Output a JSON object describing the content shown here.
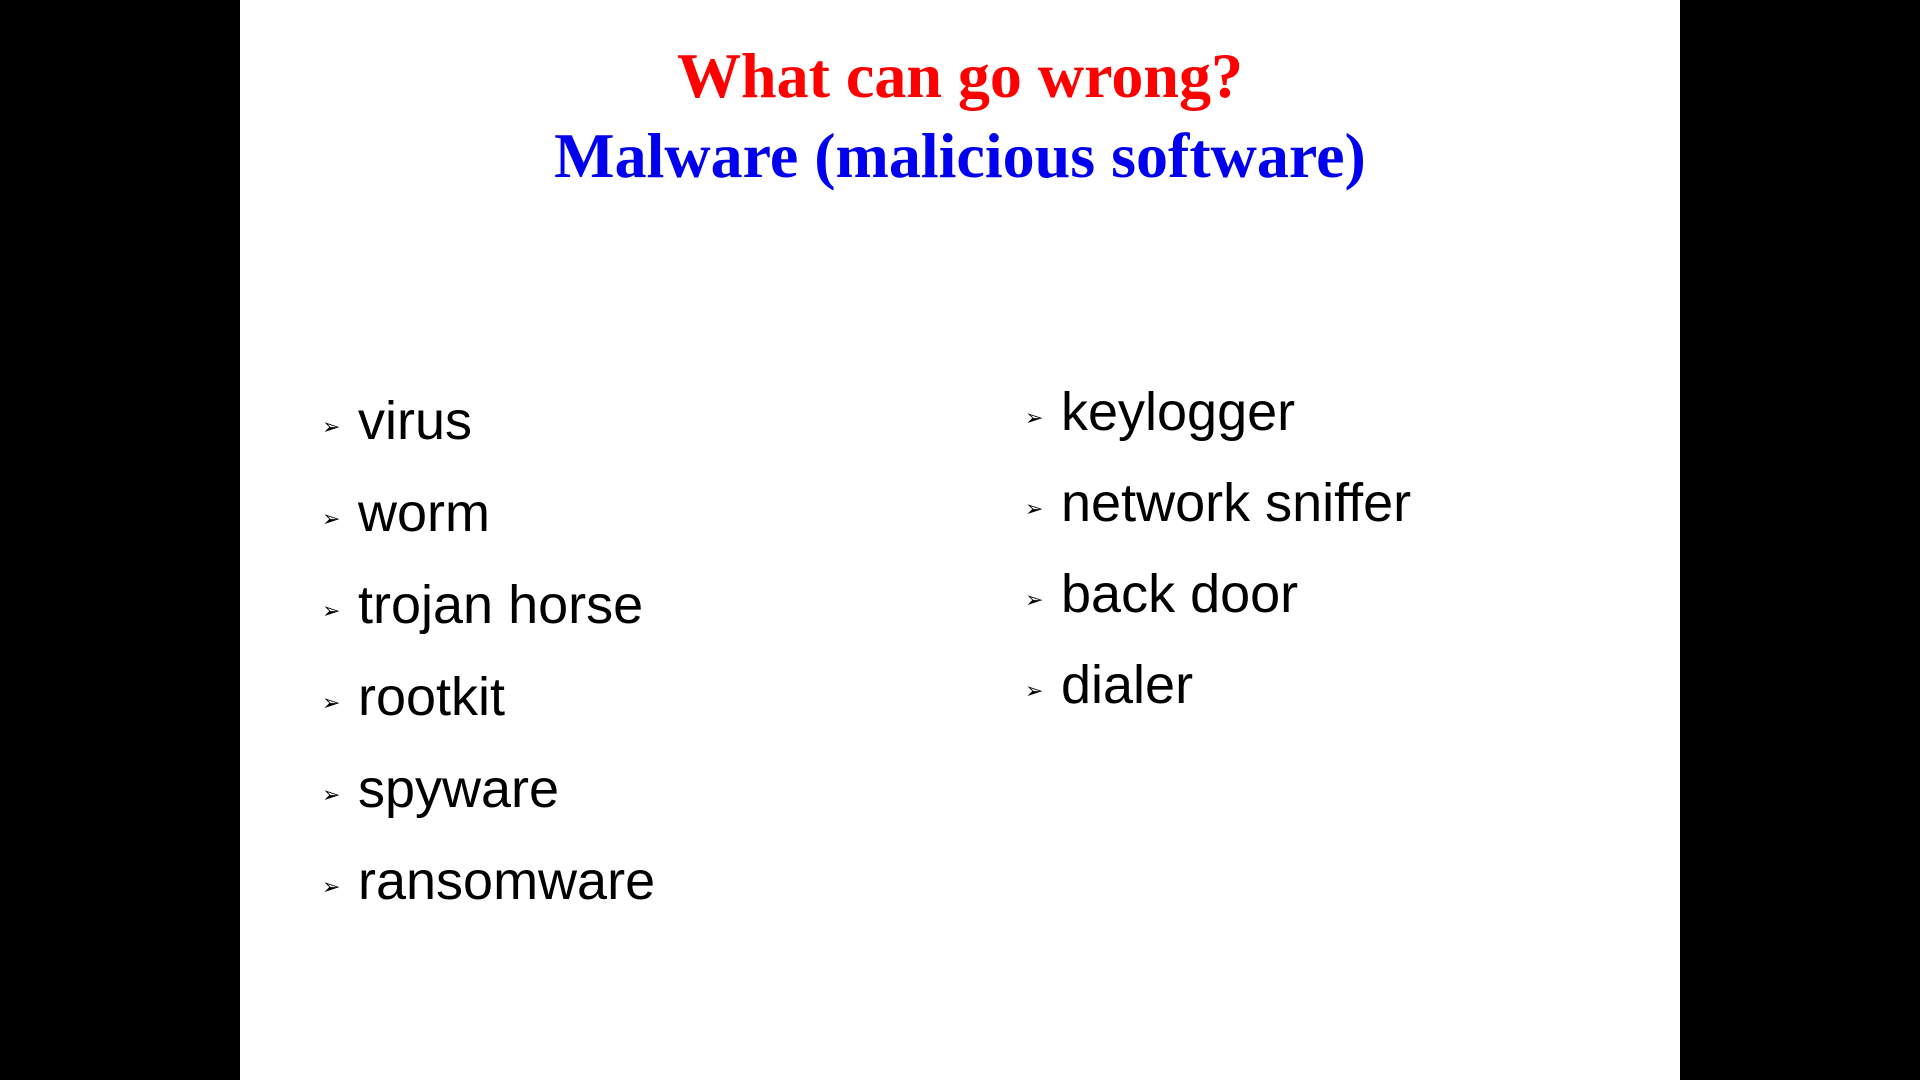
{
  "slide": {
    "title": "What can go wrong?",
    "subtitle": "Malware (malicious software)",
    "bullet_icon": "arrowhead-bullet-icon",
    "left_items": [
      {
        "label": "virus"
      },
      {
        "label": "worm"
      },
      {
        "label": "trojan horse"
      },
      {
        "label": "rootkit"
      },
      {
        "label": "spyware"
      },
      {
        "label": "ransomware"
      }
    ],
    "right_items": [
      {
        "label": "keylogger"
      },
      {
        "label": "network sniffer"
      },
      {
        "label": "back door"
      },
      {
        "label": "dialer"
      }
    ]
  },
  "colors": {
    "title": "#ff0000",
    "subtitle": "#0000ee",
    "background": "#ffffff",
    "letterbox": "#000000"
  }
}
